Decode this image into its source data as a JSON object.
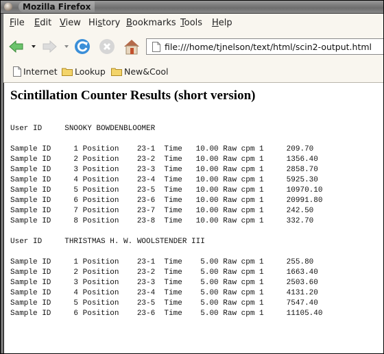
{
  "window": {
    "title": "Mozilla Firefox"
  },
  "menu": [
    {
      "label": "File",
      "accel": "F",
      "rest": "ile"
    },
    {
      "label": "Edit",
      "accel": "E",
      "rest": "dit"
    },
    {
      "label": "View",
      "accel": "V",
      "rest": "iew"
    },
    {
      "label": "History",
      "pre": "Hi",
      "accel": "s",
      "rest": "tory"
    },
    {
      "label": "Bookmarks",
      "accel": "B",
      "rest": "ookmarks"
    },
    {
      "label": "Tools",
      "accel": "T",
      "rest": "ools"
    },
    {
      "label": "Help",
      "accel": "H",
      "rest": "elp"
    }
  ],
  "toolbar": {
    "back_icon": "back-arrow-icon",
    "forward_icon": "forward-arrow-icon",
    "reload_icon": "reload-icon",
    "stop_icon": "stop-icon",
    "home_icon": "home-icon",
    "url": "file:///home/tjnelson/text/html/scin2-output.html"
  },
  "bookmarks": [
    {
      "label": "Internet",
      "icon": "page-icon"
    },
    {
      "label": "Lookup",
      "icon": "folder-icon"
    },
    {
      "label": "New&Cool",
      "icon": "folder-icon"
    }
  ],
  "page": {
    "heading": "Scintillation Counter Results (short version)",
    "users": [
      {
        "user_label": "User ID",
        "name": "SNOOKY BOWDENBLOOMER",
        "samples": [
          {
            "id": "1",
            "position": "23-1",
            "time": "10.00",
            "raw_cpm": "209.70"
          },
          {
            "id": "2",
            "position": "23-2",
            "time": "10.00",
            "raw_cpm": "1356.40"
          },
          {
            "id": "3",
            "position": "23-3",
            "time": "10.00",
            "raw_cpm": "2858.70"
          },
          {
            "id": "4",
            "position": "23-4",
            "time": "10.00",
            "raw_cpm": "5925.30"
          },
          {
            "id": "5",
            "position": "23-5",
            "time": "10.00",
            "raw_cpm": "10970.10"
          },
          {
            "id": "6",
            "position": "23-6",
            "time": "10.00",
            "raw_cpm": "20991.80"
          },
          {
            "id": "7",
            "position": "23-7",
            "time": "10.00",
            "raw_cpm": "242.50"
          },
          {
            "id": "8",
            "position": "23-8",
            "time": "10.00",
            "raw_cpm": "332.70"
          }
        ]
      },
      {
        "user_label": "User ID",
        "name": "THRISTMAS H. W. WOOLSTENDER III",
        "samples": [
          {
            "id": "1",
            "position": "23-1",
            "time": "5.00",
            "raw_cpm": "255.80"
          },
          {
            "id": "2",
            "position": "23-2",
            "time": "5.00",
            "raw_cpm": "1663.40"
          },
          {
            "id": "3",
            "position": "23-3",
            "time": "5.00",
            "raw_cpm": "2503.60"
          },
          {
            "id": "4",
            "position": "23-4",
            "time": "5.00",
            "raw_cpm": "4131.20"
          },
          {
            "id": "5",
            "position": "23-5",
            "time": "5.00",
            "raw_cpm": "7547.40"
          },
          {
            "id": "6",
            "position": "23-6",
            "time": "5.00",
            "raw_cpm": "11105.40"
          }
        ]
      }
    ],
    "labels": {
      "sample": "Sample ID",
      "position": "Position",
      "time": "Time",
      "raw": "Raw cpm 1"
    }
  }
}
